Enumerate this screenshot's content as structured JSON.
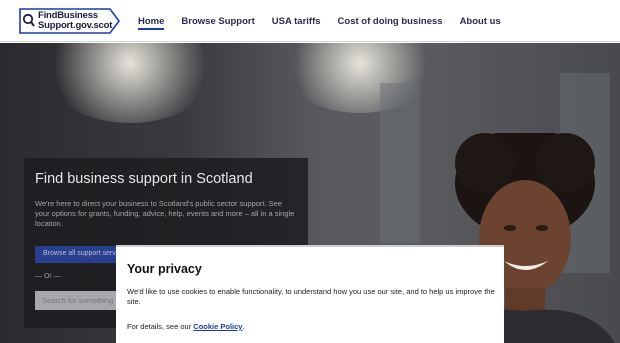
{
  "header": {
    "logo_line1": "FindBusiness",
    "logo_line2": "Support.gov.scot",
    "nav": [
      {
        "label": "Home",
        "active": true
      },
      {
        "label": "Browse Support",
        "active": false
      },
      {
        "label": "USA tariffs",
        "active": false
      },
      {
        "label": "Cost of doing business",
        "active": false
      },
      {
        "label": "About us",
        "active": false
      }
    ]
  },
  "hero": {
    "title": "Find business support in Scotland",
    "text": "We're here to direct your business to Scotland's public sector support. See your options for grants, funding, advice, help, events and more – all in a single location.",
    "browse_button": "Browse all support services",
    "or_text": "— Or —",
    "search_placeholder": "Search for something"
  },
  "cookie": {
    "title": "Your privacy",
    "text": "We'd like to use cookies to enable functionality, to understand how you use our site, and to help us improve the site.",
    "details_prefix": "For details, see our ",
    "details_link": "Cookie Policy",
    "details_suffix": "."
  },
  "colors": {
    "accent": "#1d3ba8",
    "button": "#2a3e90"
  }
}
